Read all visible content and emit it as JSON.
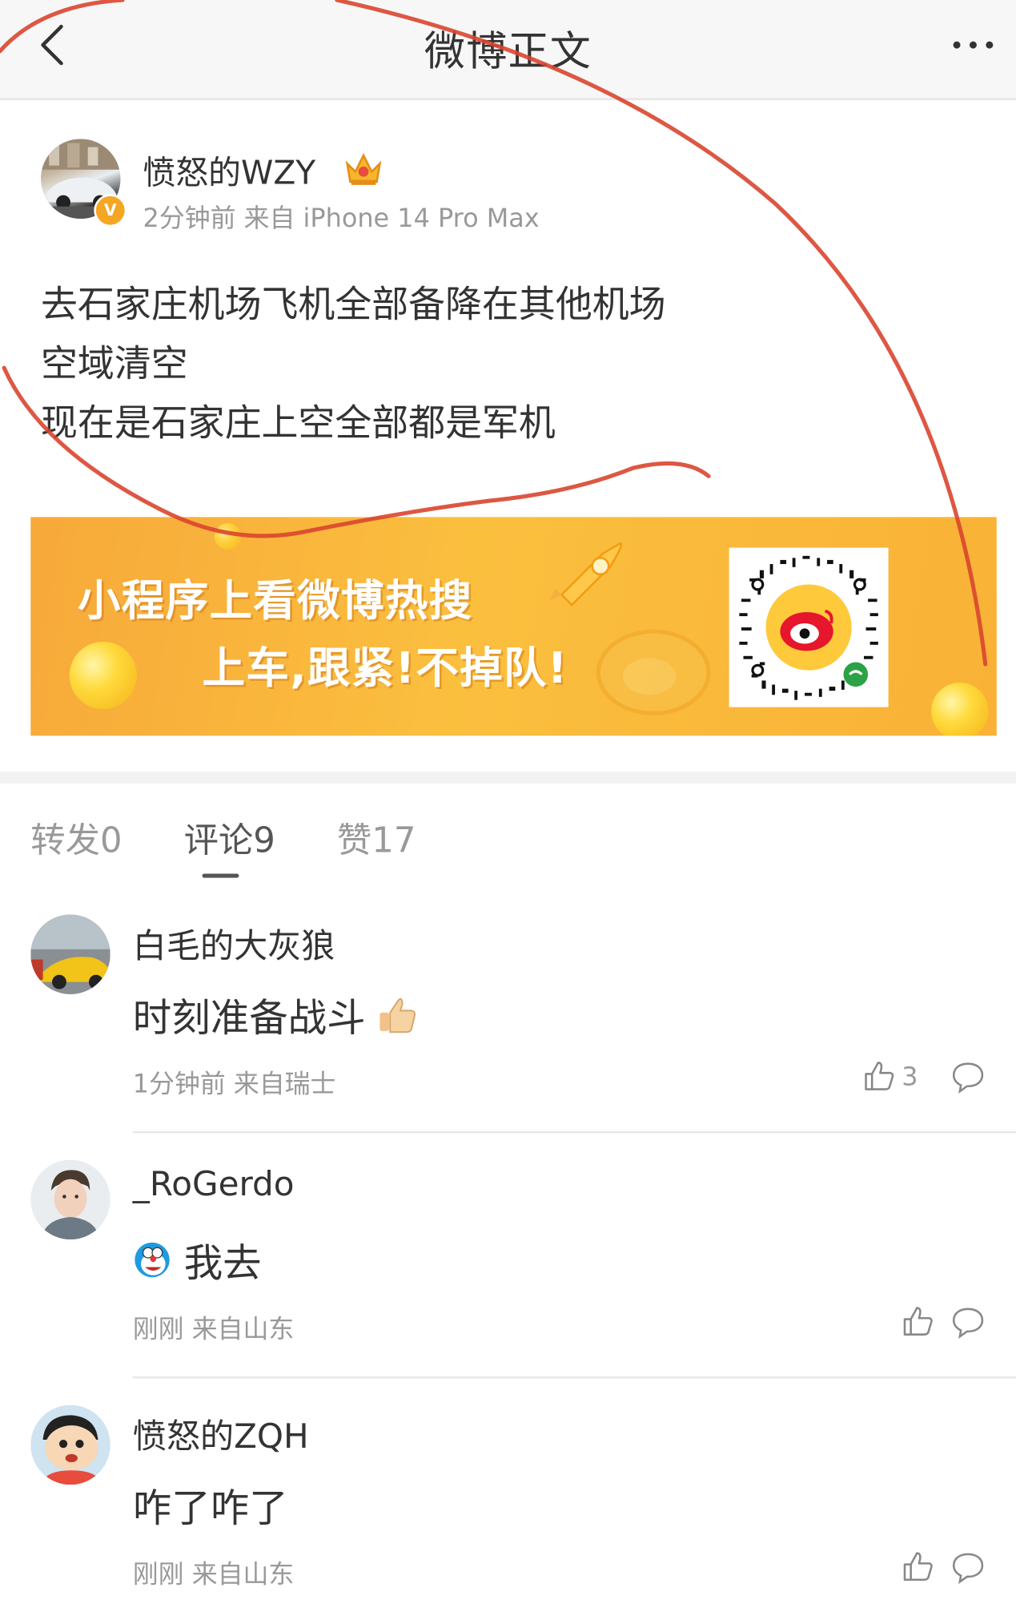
{
  "header": {
    "title": "微博正文"
  },
  "post": {
    "author": "愤怒的WZY",
    "meta": "2分钟前 来自 iPhone 14 Pro Max",
    "lines": [
      "去石家庄机场飞机全部备降在其他机场",
      "空域清空",
      "现在是石家庄上空全部都是军机"
    ],
    "banner": {
      "line1": "小程序上看微博热搜",
      "line2": "上车,跟紧!不掉队!"
    }
  },
  "tabs": [
    {
      "label": "转发0"
    },
    {
      "label": "评论9"
    },
    {
      "label": "赞17"
    }
  ],
  "comments": [
    {
      "name": "白毛的大灰狼",
      "text": "时刻准备战斗",
      "meta": "1分钟前 来自瑞士",
      "likes": "3"
    },
    {
      "name": "_RoGerdo",
      "text": "我去",
      "meta": "刚刚 来自山东",
      "likes": ""
    },
    {
      "name": "愤怒的ZQH",
      "text": "咋了咋了",
      "meta": "刚刚 来自山东",
      "likes": ""
    }
  ],
  "colors": {
    "banner": "#fbbf3e",
    "annotation": "#d9452f",
    "badge": "#f5a623"
  }
}
